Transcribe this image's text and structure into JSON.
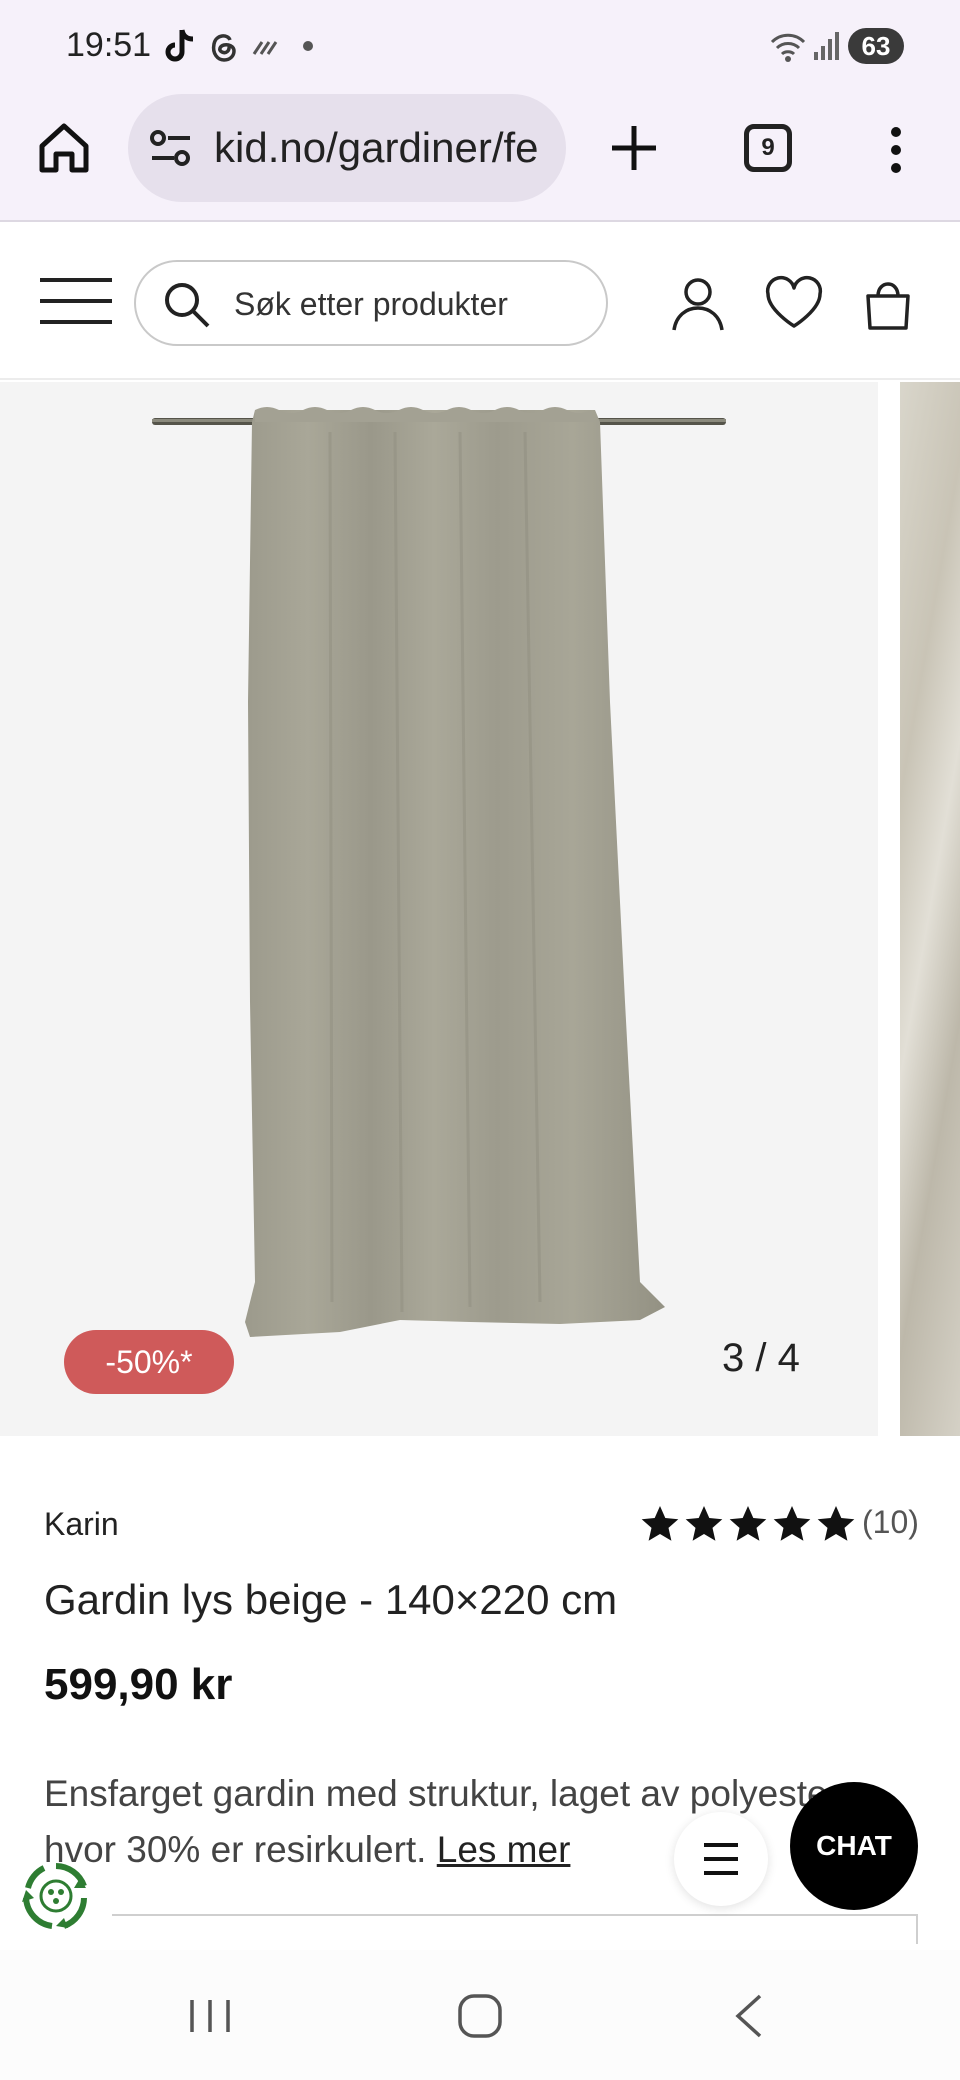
{
  "status_bar": {
    "time": "19:51",
    "battery": "63",
    "icons": [
      "tiktok-icon",
      "threads-icon",
      "wifi-calling-icon",
      "dot-icon",
      "wifi-icon",
      "signal-icon"
    ]
  },
  "browser": {
    "url": "kid.no/gardiner/fe",
    "tab_count": "9",
    "icons": [
      "home-icon",
      "site-settings-icon",
      "new-tab-icon",
      "more-vert-icon"
    ]
  },
  "header": {
    "search_placeholder": "Søk etter produkter",
    "icons": [
      "hamburger-icon",
      "search-icon",
      "account-icon",
      "heart-icon",
      "bag-icon"
    ]
  },
  "gallery": {
    "discount_badge": "-50%*",
    "counter": "3 / 4",
    "current_index": 3,
    "total": 4
  },
  "product": {
    "brand": "Karin",
    "rating": 5,
    "rating_count": "(10)",
    "title": "Gardin lys beige - 140×220 cm",
    "price": "599,90 kr",
    "description": "Ensfarget gardin med struktur, laget av polyester, hvor 30% er resirkulert.",
    "read_more": "Les mer"
  },
  "floating": {
    "chat_label": "CHAT"
  },
  "colors": {
    "badge": "#cf5a5a",
    "chat": "#000000",
    "browser_bg": "#f6f1fa",
    "eco_green": "#2e7d32"
  }
}
